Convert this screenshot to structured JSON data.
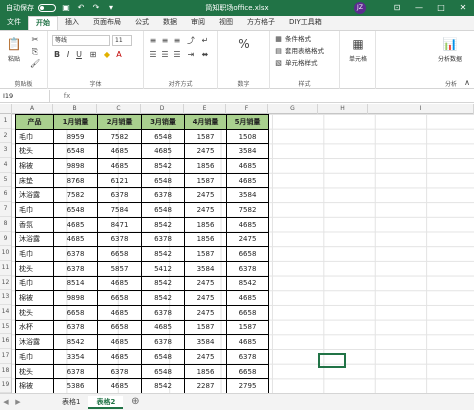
{
  "titlebar": {
    "autosave": "自动保存",
    "doc_title": "简知职场office.xlsx",
    "user_initials": "JZ",
    "colors": {
      "bar": "#217346"
    }
  },
  "tabs": [
    "文件",
    "开始",
    "插入",
    "页面布局",
    "公式",
    "数据",
    "审阅",
    "视图",
    "方方格子",
    "DIY工具箱"
  ],
  "active_tab": "开始",
  "ribbon": {
    "clipboard_label": "剪贴板",
    "paste": "粘贴",
    "font_name": "等线",
    "font_size": "11",
    "font_label": "字体",
    "align_label": "对齐方式",
    "number_label": "数字",
    "number_format": "%",
    "styles_label": "样式",
    "cond_format": "条件格式",
    "table_format": "套用表格格式",
    "cell_styles": "单元格样式",
    "cells_label": "单元格",
    "cells": "单元格",
    "analyze_label": "分析",
    "analyze": "分析数据"
  },
  "formula_bar": {
    "name_box": "I19",
    "fx": "fx",
    "value": ""
  },
  "columns": [
    "A",
    "B",
    "C",
    "D",
    "E",
    "F",
    "G",
    "H",
    "I"
  ],
  "table": {
    "headers": [
      "产品",
      "1月销量",
      "2月销量",
      "3月销量",
      "4月销量",
      "5月销量"
    ],
    "rows": [
      [
        "毛巾",
        "8959",
        "7582",
        "6548",
        "1587",
        "1508"
      ],
      [
        "枕头",
        "6548",
        "4685",
        "4685",
        "2475",
        "3584"
      ],
      [
        "棉被",
        "9898",
        "4685",
        "8542",
        "1856",
        "4685"
      ],
      [
        "床垫",
        "8768",
        "6121",
        "6548",
        "1587",
        "4685"
      ],
      [
        "沐浴露",
        "7582",
        "6378",
        "6378",
        "2475",
        "3584"
      ],
      [
        "毛巾",
        "6548",
        "7584",
        "6548",
        "2475",
        "7582"
      ],
      [
        "香氛",
        "4685",
        "8471",
        "8542",
        "1856",
        "4685"
      ],
      [
        "沐浴露",
        "4685",
        "6378",
        "6378",
        "1856",
        "2475"
      ],
      [
        "毛巾",
        "6378",
        "6658",
        "8542",
        "1587",
        "6658"
      ],
      [
        "枕头",
        "6378",
        "5857",
        "5412",
        "3584",
        "6378"
      ],
      [
        "毛巾",
        "8514",
        "4685",
        "8542",
        "2475",
        "8542"
      ],
      [
        "棉被",
        "9898",
        "6658",
        "8542",
        "2475",
        "4685"
      ],
      [
        "枕头",
        "6658",
        "4685",
        "6378",
        "2475",
        "6658"
      ],
      [
        "水杯",
        "6378",
        "6658",
        "4685",
        "1587",
        "1587"
      ],
      [
        "沐浴露",
        "8542",
        "4685",
        "6378",
        "3584",
        "4685"
      ],
      [
        "毛巾",
        "3354",
        "4685",
        "6548",
        "2475",
        "6378"
      ],
      [
        "枕头",
        "6378",
        "6378",
        "6548",
        "1856",
        "6658"
      ],
      [
        "棉被",
        "5386",
        "4685",
        "8542",
        "2287",
        "2795"
      ]
    ]
  },
  "row_numbers": [
    "1",
    "2",
    "3",
    "4",
    "5",
    "6",
    "7",
    "8",
    "9",
    "10",
    "11",
    "12",
    "13",
    "14",
    "15",
    "16",
    "17",
    "18",
    "19",
    "20"
  ],
  "sheets": [
    "表格1",
    "表格2"
  ],
  "active_sheet": "表格2"
}
